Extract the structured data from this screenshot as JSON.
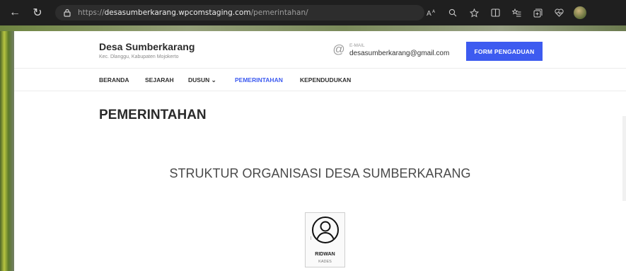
{
  "browser": {
    "url_prefix": "https://",
    "url_host": "desasumberkarang.wpcomstaging.com",
    "url_path": "/pemerintahan/",
    "back_glyph": "←",
    "refresh_glyph": "↻"
  },
  "site": {
    "name": "Desa Sumberkarang",
    "tagline": "Kec. Dlanggu, Kabupaten Mojokerto",
    "email_label": "E-MAIL",
    "email": "desasumberkarang@gmail.com",
    "cta_label": "FORM PENGADUAN"
  },
  "menu": {
    "items": [
      {
        "label": "BERANDA"
      },
      {
        "label": "SEJARAH"
      },
      {
        "label": "DUSUN ⌄"
      },
      {
        "label": "PEMERINTAHAN"
      },
      {
        "label": "KEPENDUDUKAN"
      }
    ],
    "active": "PEMERINTAHAN"
  },
  "page": {
    "title": "PEMERINTAHAN",
    "section_title": "STRUKTUR ORGANISASI DESA SUMBERKARANG"
  },
  "org": {
    "name": "RIDWAN",
    "role": "KADES"
  },
  "colors": {
    "accent": "#3d5bf0",
    "text": "#2a2a2a"
  }
}
